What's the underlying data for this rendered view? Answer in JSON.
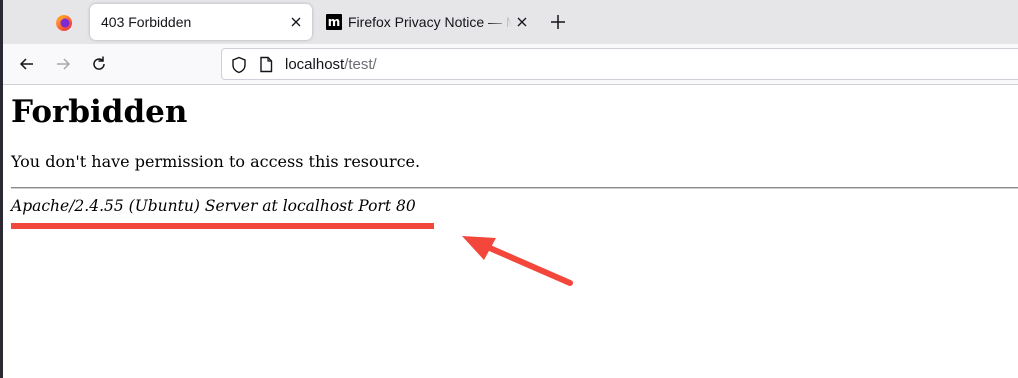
{
  "browser": {
    "tabs": [
      {
        "title": "403 Forbidden",
        "active": true
      },
      {
        "title": "Firefox Privacy Notice — Mozilla",
        "active": false
      }
    ],
    "url": {
      "host": "localhost",
      "path": "/test/"
    }
  },
  "page": {
    "title": "Forbidden",
    "message": "You don't have permission to access this resource.",
    "server_signature": "Apache/2.4.55 (Ubuntu) Server at localhost Port 80"
  },
  "annotation": {
    "color": "#f2473a"
  },
  "colors": {
    "tabbar_bg": "#e6e6e9",
    "navbar_bg": "#f9f9fb"
  }
}
